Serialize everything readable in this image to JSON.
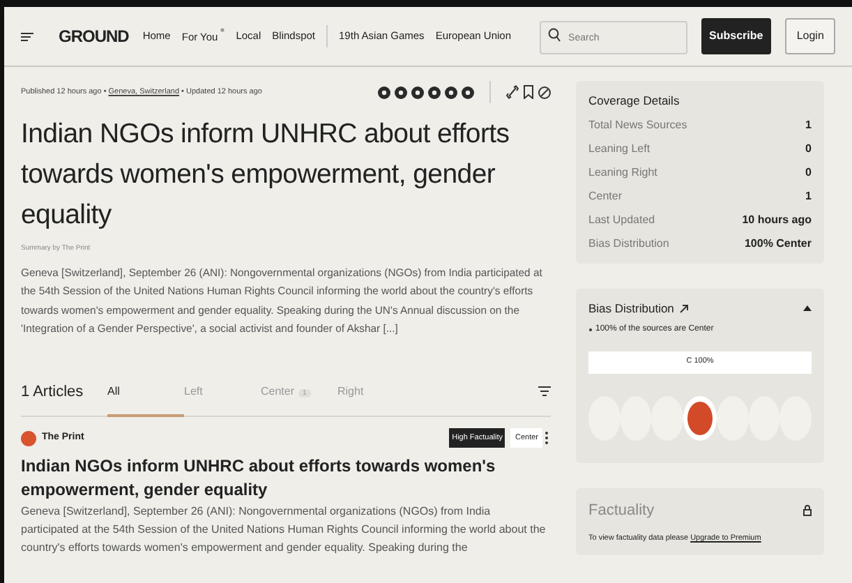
{
  "header": {
    "logo": "GROUND",
    "nav": [
      {
        "label": "Home",
        "flag": false
      },
      {
        "label": "For You",
        "flag": true
      },
      {
        "label": "Local",
        "flag": false
      },
      {
        "label": "Blindspot",
        "flag": false
      },
      {
        "label": "19th Asian Games",
        "flag": false
      },
      {
        "label": "European Union",
        "flag": false
      }
    ],
    "search": {
      "placeholder": "Search"
    },
    "subscribe": "Subscribe",
    "login": "Login"
  },
  "story": {
    "published": "Published 12 hours ago",
    "separators": [
      "•",
      "•"
    ],
    "location": "Geneva, Switzerland",
    "updated": "Updated 12 hours ago",
    "title": "Indian NGOs inform UNHRC about efforts towards women's empowerment, gender equality",
    "summary_by": "Summary by The Print",
    "summary": "Geneva [Switzerland], September 26 (ANI): Nongovernmental organizations (NGOs) from India participated at the 54th Session of the United Nations Human Rights Council informing the world about the country's efforts towards women's empowerment and gender equality. Speaking during the UN's Annual discussion on the 'Integration of a Gender Perspective', a social activist and founder of Akshar [...]"
  },
  "articles": {
    "count": "1 Articles",
    "tabs": [
      {
        "label": "All",
        "selected": true
      },
      {
        "label": "Left",
        "selected": false
      },
      {
        "label": "Center",
        "count": "1",
        "selected": false
      },
      {
        "label": "Right",
        "selected": false
      }
    ],
    "items": [
      {
        "source": "The Print",
        "factuality": "High Factuality",
        "bias": "Center",
        "title": "Indian NGOs inform UNHRC about efforts towards women's empowerment, gender equality",
        "text": "Geneva [Switzerland], September 26 (ANI): Nongovernmental organizations (NGOs) from India participated at the 54th Session of the United Nations Human Rights Council informing the world about the country's efforts towards women's empowerment and gender equality. Speaking during the"
      }
    ]
  },
  "coverage": {
    "title": "Coverage Details",
    "rows": [
      {
        "label": "Total News Sources",
        "value": "1"
      },
      {
        "label": "Leaning Left",
        "value": "0"
      },
      {
        "label": "Leaning Right",
        "value": "0"
      },
      {
        "label": "Center",
        "value": "1"
      },
      {
        "label": "Last Updated",
        "value": "10 hours ago"
      },
      {
        "label": "Bias Distribution",
        "value": "100% Center"
      }
    ]
  },
  "bias_distribution": {
    "title": "Bias Distribution",
    "note": "100% of the sources are Center",
    "bar": {
      "label": "C 100%"
    },
    "slots": [
      {
        "filled": false
      },
      {
        "filled": false
      },
      {
        "filled": false
      },
      {
        "filled": true
      },
      {
        "filled": false
      },
      {
        "filled": false
      },
      {
        "filled": false
      }
    ]
  },
  "factuality": {
    "title": "Factuality",
    "text": "To view factuality data please",
    "link": "Upgrade to Premium"
  }
}
